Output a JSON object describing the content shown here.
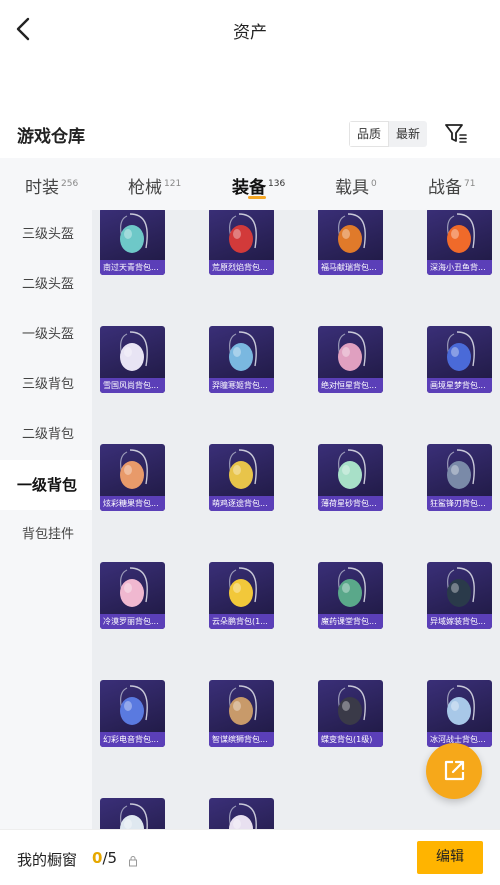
{
  "header": {
    "title": "资产",
    "back_icon": "back-chevron-icon"
  },
  "section": {
    "title": "游戏仓库",
    "sort_options": [
      "品质",
      "最新"
    ],
    "sort_selected": "品质",
    "filter_icon": "filter-icon"
  },
  "tabs": [
    {
      "label": "时装",
      "count": "256"
    },
    {
      "label": "枪械",
      "count": "121"
    },
    {
      "label": "装备",
      "count": "136"
    },
    {
      "label": "载具",
      "count": "0"
    },
    {
      "label": "战备",
      "count": "71"
    }
  ],
  "active_tab": "装备",
  "sidebar": {
    "items": [
      "三级头盔",
      "二级头盔",
      "一级头盔",
      "三级背包",
      "二级背包",
      "一级背包",
      "背包挂件"
    ],
    "active": "一级背包"
  },
  "items": [
    {
      "name": "南过天青背包...",
      "color": "#6ec8c8"
    },
    {
      "name": "荒原烈焰背包...",
      "color": "#d23a3a"
    },
    {
      "name": "福马献瑞背包...",
      "color": "#e07a2a"
    },
    {
      "name": "深海小丑鱼背...",
      "color": "#f06a2a"
    },
    {
      "name": "雪国风尚背包...",
      "color": "#e8e4f4"
    },
    {
      "name": "羿瞳寒姬背包...",
      "color": "#7ab8e0"
    },
    {
      "name": "绝对恒星背包...",
      "color": "#e0a0c0"
    },
    {
      "name": "画境星梦背包...",
      "color": "#4a6ad8"
    },
    {
      "name": "炫彩糖果背包...",
      "color": "#e89a6a"
    },
    {
      "name": "萌鸡逐途背包...",
      "color": "#e8c44a"
    },
    {
      "name": "薄荷星砂背包...",
      "color": "#a8e0c8"
    },
    {
      "name": "狂鲨锋刃背包...",
      "color": "#7a8aa8"
    },
    {
      "name": "冷漠罗丽背包...",
      "color": "#f0b8d0"
    },
    {
      "name": "云朵鹏背包(1...",
      "color": "#f2c83a"
    },
    {
      "name": "魔药课堂背包...",
      "color": "#5aa88a"
    },
    {
      "name": "异域嫁装背包...",
      "color": "#2a3a4a"
    },
    {
      "name": "幻彩电音背包...",
      "color": "#5a7ae0"
    },
    {
      "name": "智谋缤狮背包...",
      "color": "#c89a6a"
    },
    {
      "name": "蝶变背包(1级)",
      "color": "#3a3a48"
    },
    {
      "name": "冰河战士背包...",
      "color": "#a8c8e8"
    },
    {
      "name": "",
      "color": "#dfe8f0"
    },
    {
      "name": "",
      "color": "#e8e0f0"
    }
  ],
  "fab": {
    "icon": "share-external-icon"
  },
  "bottom": {
    "showcase_label": "我的橱窗",
    "showcase_current": "0",
    "showcase_total": "/5",
    "lock_icon": "lock-icon",
    "edit_label": "编辑"
  }
}
